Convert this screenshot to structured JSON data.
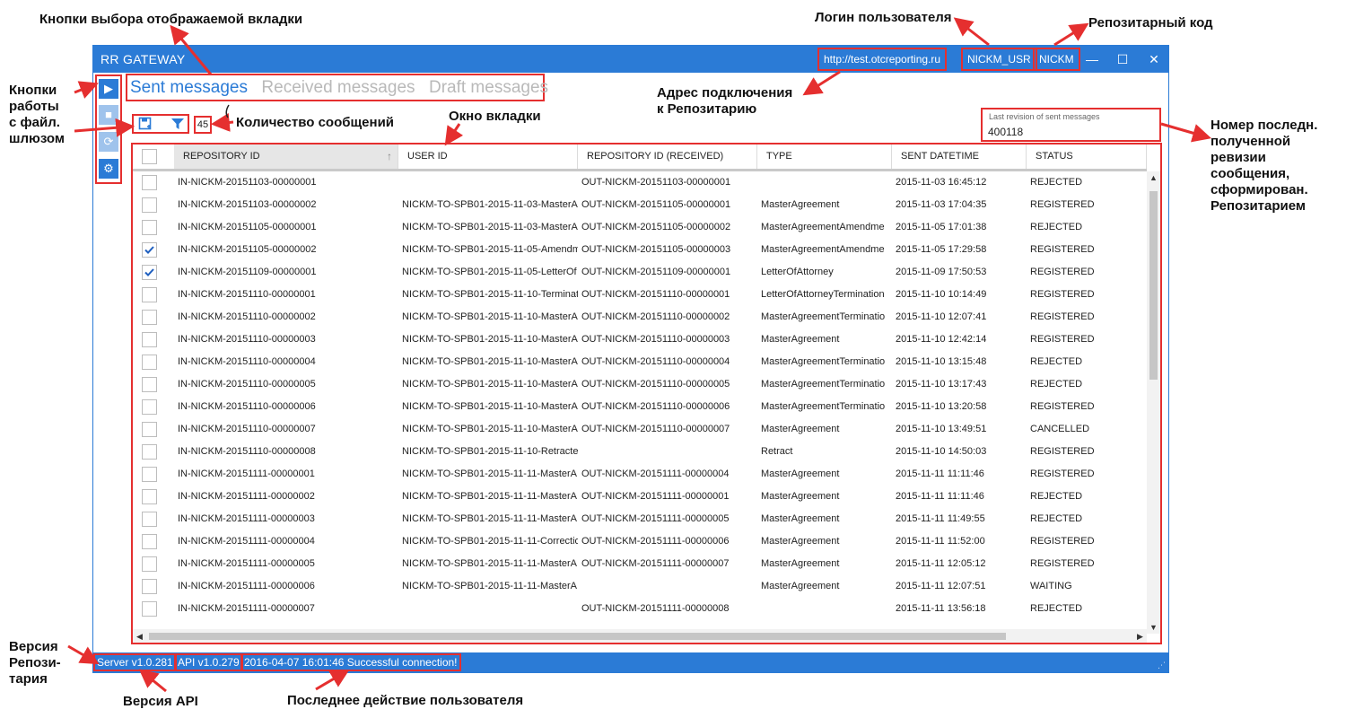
{
  "window": {
    "title": "RR GATEWAY",
    "server_url": "http://test.otcreporting.ru",
    "user_login": "NICKM_USR",
    "repository_code": "NICKM",
    "controls": {
      "minimize": "—",
      "maximize": "☐",
      "close": "✕"
    }
  },
  "left_toolbar": {
    "buttons": [
      {
        "icon": "play-icon",
        "glyph": "▶",
        "enabled": true
      },
      {
        "icon": "stop-icon",
        "glyph": "■",
        "enabled": false
      },
      {
        "icon": "refresh-icon",
        "glyph": "⟳",
        "enabled": false
      },
      {
        "icon": "gear-icon",
        "glyph": "⚙",
        "enabled": true
      }
    ]
  },
  "tabs": [
    {
      "label": "Sent messages",
      "active": true
    },
    {
      "label": "Received messages",
      "active": false
    },
    {
      "label": "Draft messages",
      "active": false
    }
  ],
  "actions": {
    "save_icon": "save-icon",
    "filter_icon": "filter-icon"
  },
  "message_count": "45",
  "revision": {
    "label": "Last revision of sent messages",
    "value": "400118"
  },
  "grid": {
    "columns": [
      "REPOSITORY ID",
      "USER ID",
      "REPOSITORY ID (RECEIVED)",
      "TYPE",
      "SENT DATETIME",
      "STATUS"
    ],
    "sorted_column": 0,
    "rows": [
      {
        "checked": false,
        "repository_id": "IN-NICKM-20151103-00000001",
        "user_id": "",
        "received_id": "OUT-NICKM-20151103-00000001",
        "type": "",
        "sent": "2015-11-03 16:45:12",
        "status": "REJECTED"
      },
      {
        "checked": false,
        "repository_id": "IN-NICKM-20151103-00000002",
        "user_id": "NICKM-TO-SPB01-2015-11-03-MasterA",
        "received_id": "OUT-NICKM-20151105-00000001",
        "type": "MasterAgreement",
        "sent": "2015-11-03 17:04:35",
        "status": "REGISTERED"
      },
      {
        "checked": false,
        "repository_id": "IN-NICKM-20151105-00000001",
        "user_id": "NICKM-TO-SPB01-2015-11-03-MasterA",
        "received_id": "OUT-NICKM-20151105-00000002",
        "type": "MasterAgreementAmendme",
        "sent": "2015-11-05 17:01:38",
        "status": "REJECTED"
      },
      {
        "checked": true,
        "repository_id": "IN-NICKM-20151105-00000002",
        "user_id": "NICKM-TO-SPB01-2015-11-05-Amendm",
        "received_id": "OUT-NICKM-20151105-00000003",
        "type": "MasterAgreementAmendme",
        "sent": "2015-11-05 17:29:58",
        "status": "REGISTERED"
      },
      {
        "checked": true,
        "repository_id": "IN-NICKM-20151109-00000001",
        "user_id": "NICKM-TO-SPB01-2015-11-05-LetterOf",
        "received_id": "OUT-NICKM-20151109-00000001",
        "type": "LetterOfAttorney",
        "sent": "2015-11-09 17:50:53",
        "status": "REGISTERED"
      },
      {
        "checked": false,
        "repository_id": "IN-NICKM-20151110-00000001",
        "user_id": "NICKM-TO-SPB01-2015-11-10-Terminat",
        "received_id": "OUT-NICKM-20151110-00000001",
        "type": "LetterOfAttorneyTermination",
        "sent": "2015-11-10 10:14:49",
        "status": "REGISTERED"
      },
      {
        "checked": false,
        "repository_id": "IN-NICKM-20151110-00000002",
        "user_id": "NICKM-TO-SPB01-2015-11-10-MasterA",
        "received_id": "OUT-NICKM-20151110-00000002",
        "type": "MasterAgreementTerminatio",
        "sent": "2015-11-10 12:07:41",
        "status": "REGISTERED"
      },
      {
        "checked": false,
        "repository_id": "IN-NICKM-20151110-00000003",
        "user_id": "NICKM-TO-SPB01-2015-11-10-MasterA",
        "received_id": "OUT-NICKM-20151110-00000003",
        "type": "MasterAgreement",
        "sent": "2015-11-10 12:42:14",
        "status": "REGISTERED"
      },
      {
        "checked": false,
        "repository_id": "IN-NICKM-20151110-00000004",
        "user_id": "NICKM-TO-SPB01-2015-11-10-MasterA",
        "received_id": "OUT-NICKM-20151110-00000004",
        "type": "MasterAgreementTerminatio",
        "sent": "2015-11-10 13:15:48",
        "status": "REJECTED"
      },
      {
        "checked": false,
        "repository_id": "IN-NICKM-20151110-00000005",
        "user_id": "NICKM-TO-SPB01-2015-11-10-MasterA",
        "received_id": "OUT-NICKM-20151110-00000005",
        "type": "MasterAgreementTerminatio",
        "sent": "2015-11-10 13:17:43",
        "status": "REJECTED"
      },
      {
        "checked": false,
        "repository_id": "IN-NICKM-20151110-00000006",
        "user_id": "NICKM-TO-SPB01-2015-11-10-MasterA",
        "received_id": "OUT-NICKM-20151110-00000006",
        "type": "MasterAgreementTerminatio",
        "sent": "2015-11-10 13:20:58",
        "status": "REGISTERED"
      },
      {
        "checked": false,
        "repository_id": "IN-NICKM-20151110-00000007",
        "user_id": "NICKM-TO-SPB01-2015-11-10-MasterA",
        "received_id": "OUT-NICKM-20151110-00000007",
        "type": "MasterAgreement",
        "sent": "2015-11-10 13:49:51",
        "status": "CANCELLED"
      },
      {
        "checked": false,
        "repository_id": "IN-NICKM-20151110-00000008",
        "user_id": "NICKM-TO-SPB01-2015-11-10-Retracte",
        "received_id": "",
        "type": "Retract",
        "sent": "2015-11-10 14:50:03",
        "status": "REGISTERED"
      },
      {
        "checked": false,
        "repository_id": "IN-NICKM-20151111-00000001",
        "user_id": "NICKM-TO-SPB01-2015-11-11-MasterA",
        "received_id": "OUT-NICKM-20151111-00000004",
        "type": "MasterAgreement",
        "sent": "2015-11-11 11:11:46",
        "status": "REGISTERED"
      },
      {
        "checked": false,
        "repository_id": "IN-NICKM-20151111-00000002",
        "user_id": "NICKM-TO-SPB01-2015-11-11-MasterA",
        "received_id": "OUT-NICKM-20151111-00000001",
        "type": "MasterAgreement",
        "sent": "2015-11-11 11:11:46",
        "status": "REJECTED"
      },
      {
        "checked": false,
        "repository_id": "IN-NICKM-20151111-00000003",
        "user_id": "NICKM-TO-SPB01-2015-11-11-MasterA",
        "received_id": "OUT-NICKM-20151111-00000005",
        "type": "MasterAgreement",
        "sent": "2015-11-11 11:49:55",
        "status": "REJECTED"
      },
      {
        "checked": false,
        "repository_id": "IN-NICKM-20151111-00000004",
        "user_id": "NICKM-TO-SPB01-2015-11-11-Correctio",
        "received_id": "OUT-NICKM-20151111-00000006",
        "type": "MasterAgreement",
        "sent": "2015-11-11 11:52:00",
        "status": "REGISTERED"
      },
      {
        "checked": false,
        "repository_id": "IN-NICKM-20151111-00000005",
        "user_id": "NICKM-TO-SPB01-2015-11-11-MasterA",
        "received_id": "OUT-NICKM-20151111-00000007",
        "type": "MasterAgreement",
        "sent": "2015-11-11 12:05:12",
        "status": "REGISTERED"
      },
      {
        "checked": false,
        "repository_id": "IN-NICKM-20151111-00000006",
        "user_id": "NICKM-TO-SPB01-2015-11-11-MasterA",
        "received_id": "",
        "type": "MasterAgreement",
        "sent": "2015-11-11 12:07:51",
        "status": "WAITING"
      },
      {
        "checked": false,
        "repository_id": "IN-NICKM-20151111-00000007",
        "user_id": "",
        "received_id": "OUT-NICKM-20151111-00000008",
        "type": "",
        "sent": "2015-11-11 13:56:18",
        "status": "REJECTED"
      }
    ]
  },
  "statusbar": {
    "server_version": "Server v1.0.281",
    "api_version": "API v1.0.279",
    "last_action": "2016-04-07 16:01:46 Successful connection!"
  },
  "annotations": {
    "tab_buttons": "Кнопки выбора отображаемой вкладки",
    "user_login": "Логин пользователя",
    "repo_code": "Репозитарный код",
    "file_gateway_buttons": "Кнопки\nработы\nс файл.\nшлюзом",
    "connection_address": "Адрес подключения\nк Репозитарию",
    "message_count": "Количество сообщений",
    "tab_window": "Окно вкладки",
    "last_revision": "Номер последн.\nполученной\nревизии\nсообщения,\nсформирован.\nРепозитарием",
    "repo_version": "Версия\nРепози-\nтария",
    "api_version": "Версия API",
    "last_user_action": "Последнее действие пользователя"
  },
  "colors": {
    "accent": "#2b7bd6",
    "highlight": "#e52f2f"
  }
}
